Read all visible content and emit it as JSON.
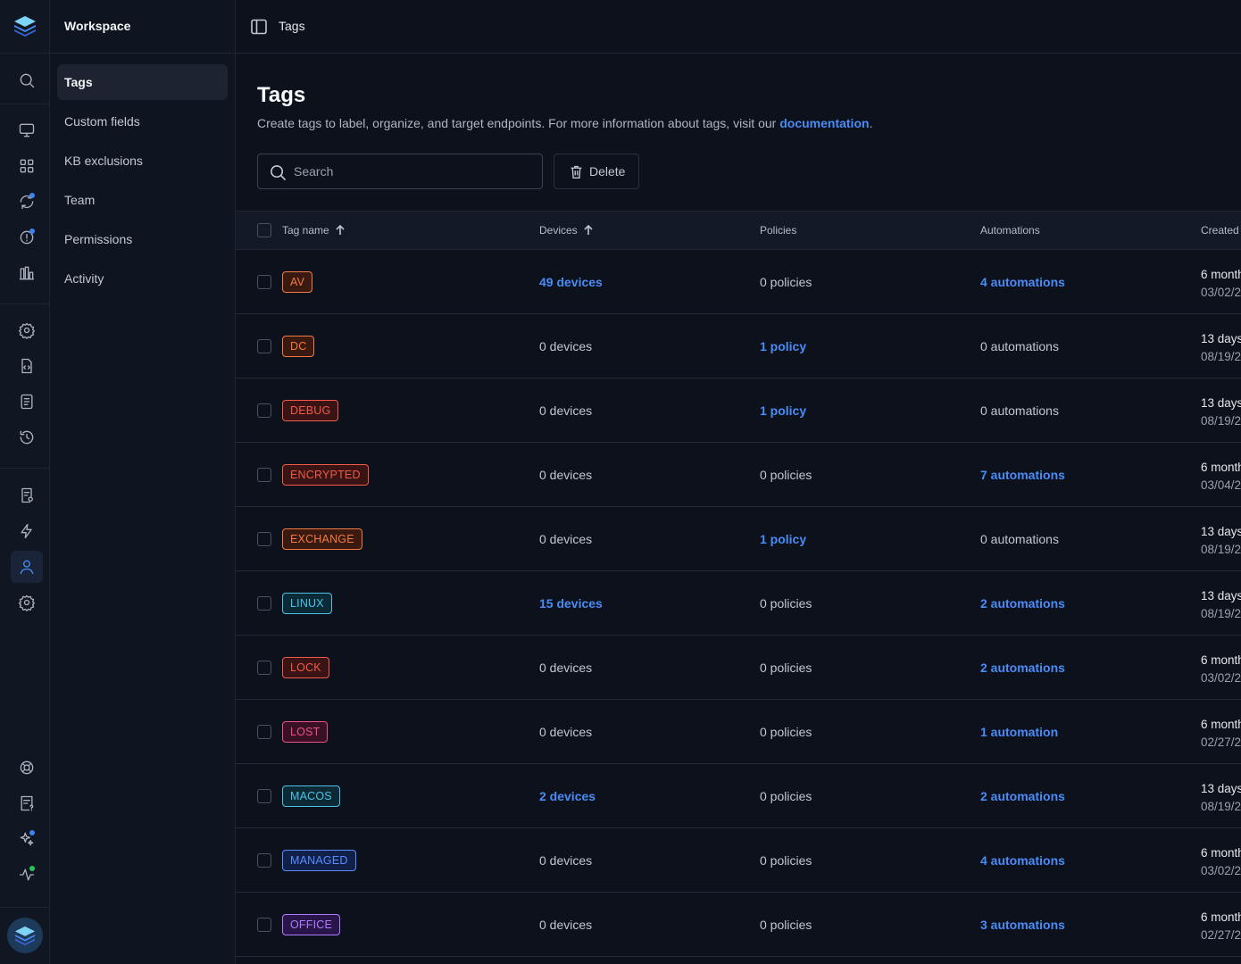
{
  "sidebar": {
    "workspace_label": "Workspace",
    "items": [
      {
        "label": "Tags",
        "active": true
      },
      {
        "label": "Custom fields"
      },
      {
        "label": "KB exclusions"
      },
      {
        "label": "Team"
      },
      {
        "label": "Permissions"
      },
      {
        "label": "Activity"
      }
    ]
  },
  "rail_icons": [
    "search-icon",
    "monitor-icon",
    "apps-grid-icon",
    "sync-icon",
    "alert-circle-icon",
    "chart-bar-icon",
    "gear-icon",
    "code-file-icon",
    "document-icon",
    "history-icon",
    "report-icon",
    "lightning-icon",
    "user-icon",
    "settings-icon",
    "lifebuoy-icon",
    "help-doc-icon",
    "sparkles-icon",
    "activity-icon"
  ],
  "header": {
    "breadcrumb": "Tags"
  },
  "page": {
    "title": "Tags",
    "description": "Create tags to label, organize, and target endpoints. For more information about tags, visit our",
    "doc_link": "documentation",
    "doc_suffix": "."
  },
  "toolbar": {
    "search_placeholder": "Search",
    "delete_label": "Delete"
  },
  "table": {
    "columns": {
      "tag_name": "Tag name",
      "devices": "Devices",
      "policies": "Policies",
      "automations": "Automations",
      "created": "Created"
    },
    "rows": [
      {
        "tag": "AV",
        "color": "#f07a40",
        "bg": "#3a1a10",
        "devices": "49 devices",
        "devices_link": true,
        "policies": "0 policies",
        "policies_link": false,
        "automations": "4 automations",
        "automations_link": true,
        "created_rel": "6 month",
        "created_date": "03/02/2"
      },
      {
        "tag": "DC",
        "color": "#f07a40",
        "bg": "#3a1a10",
        "devices": "0 devices",
        "devices_link": false,
        "policies": "1 policy",
        "policies_link": true,
        "automations": "0 automations",
        "automations_link": false,
        "created_rel": "13 days",
        "created_date": "08/19/2"
      },
      {
        "tag": "DEBUG",
        "color": "#ef5a4a",
        "bg": "#3a1414",
        "devices": "0 devices",
        "devices_link": false,
        "policies": "1 policy",
        "policies_link": true,
        "automations": "0 automations",
        "automations_link": false,
        "created_rel": "13 days",
        "created_date": "08/19/2"
      },
      {
        "tag": "ENCRYPTED",
        "color": "#ef5a4a",
        "bg": "#3a1414",
        "devices": "0 devices",
        "devices_link": false,
        "policies": "0 policies",
        "policies_link": false,
        "automations": "7 automations",
        "automations_link": true,
        "created_rel": "6 month",
        "created_date": "03/04/2"
      },
      {
        "tag": "EXCHANGE",
        "color": "#f07a40",
        "bg": "#3a1a10",
        "devices": "0 devices",
        "devices_link": false,
        "policies": "1 policy",
        "policies_link": true,
        "automations": "0 automations",
        "automations_link": false,
        "created_rel": "13 days",
        "created_date": "08/19/2"
      },
      {
        "tag": "LINUX",
        "color": "#4cc3e6",
        "bg": "#0c2a36",
        "devices": "15 devices",
        "devices_link": true,
        "policies": "0 policies",
        "policies_link": false,
        "automations": "2 automations",
        "automations_link": true,
        "created_rel": "13 days",
        "created_date": "08/19/2"
      },
      {
        "tag": "LOCK",
        "color": "#ef5a4a",
        "bg": "#3a1414",
        "devices": "0 devices",
        "devices_link": false,
        "policies": "0 policies",
        "policies_link": false,
        "automations": "2 automations",
        "automations_link": true,
        "created_rel": "6 month",
        "created_date": "03/02/2"
      },
      {
        "tag": "LOST",
        "color": "#e8508e",
        "bg": "#3a1024",
        "devices": "0 devices",
        "devices_link": false,
        "policies": "0 policies",
        "policies_link": false,
        "automations": "1 automation",
        "automations_link": true,
        "created_rel": "6 month",
        "created_date": "02/27/2"
      },
      {
        "tag": "MACOS",
        "color": "#4cc3e6",
        "bg": "#0c2a36",
        "devices": "2 devices",
        "devices_link": true,
        "policies": "0 policies",
        "policies_link": false,
        "automations": "2 automations",
        "automations_link": true,
        "created_rel": "13 days",
        "created_date": "08/19/2"
      },
      {
        "tag": "MANAGED",
        "color": "#5b8cff",
        "bg": "#102048",
        "devices": "0 devices",
        "devices_link": false,
        "policies": "0 policies",
        "policies_link": false,
        "automations": "4 automations",
        "automations_link": true,
        "created_rel": "6 month",
        "created_date": "03/02/2"
      },
      {
        "tag": "OFFICE",
        "color": "#b07cff",
        "bg": "#28164a",
        "devices": "0 devices",
        "devices_link": false,
        "policies": "0 policies",
        "policies_link": false,
        "automations": "3 automations",
        "automations_link": true,
        "created_rel": "6 month",
        "created_date": "02/27/2"
      }
    ]
  },
  "colors": {
    "accent": "#4a8cf7",
    "background": "#0c111b",
    "sidebar": "#111722"
  }
}
